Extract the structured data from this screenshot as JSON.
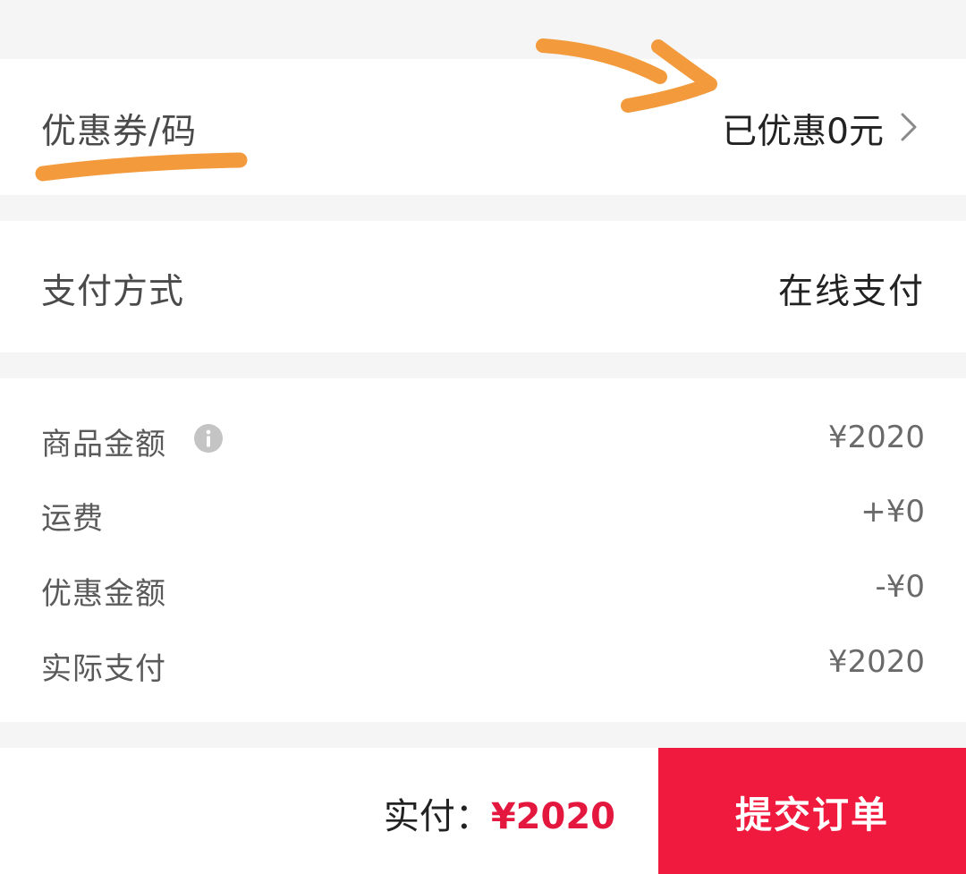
{
  "coupon": {
    "label": "优惠券/码",
    "value": "已优惠0元",
    "chevron_icon": "chevron-right-icon"
  },
  "payment": {
    "label": "支付方式",
    "value": "在线支付"
  },
  "summary": {
    "items": [
      {
        "label": "商品金额",
        "value": "¥2020"
      },
      {
        "label": "运费",
        "value": "+¥0"
      },
      {
        "label": "优惠金额",
        "value": "-¥0"
      },
      {
        "label": "实际支付",
        "value": "¥2020"
      }
    ],
    "info_icon": "info-icon"
  },
  "footer": {
    "pay_label": "实付：",
    "pay_amount": "¥2020",
    "submit_label": "提交订单"
  },
  "colors": {
    "accent": "#ef1a3d",
    "price": "#e4173e",
    "annotation": "#f39a3c",
    "background": "#f5f5f5"
  }
}
